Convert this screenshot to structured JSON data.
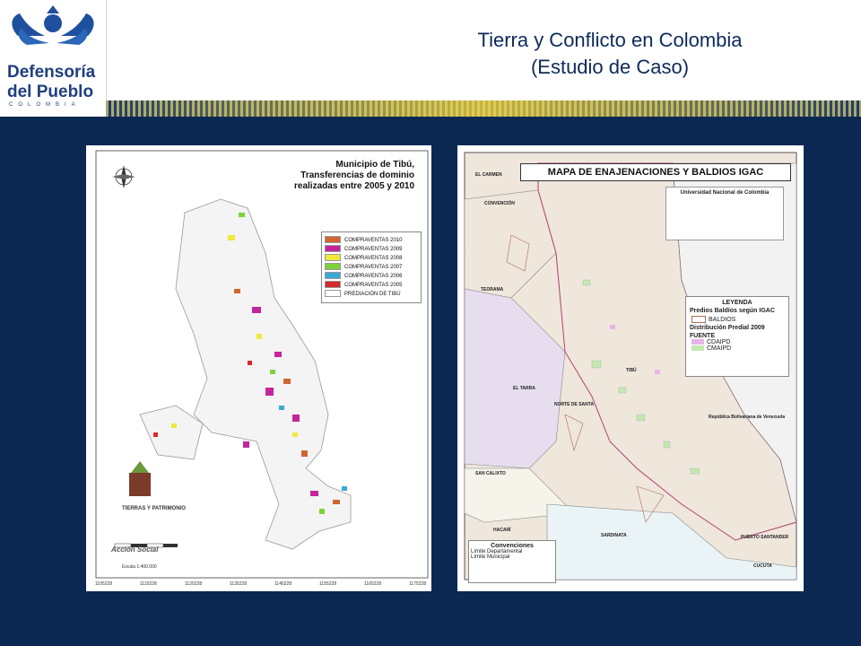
{
  "header": {
    "logo": {
      "line1": "Defensoría",
      "line2": "del Pueblo",
      "line3": "COLOMBIA"
    },
    "title_line1": "Tierra y Conflicto en Colombia",
    "title_line2": "(Estudio de Caso)"
  },
  "left_map": {
    "title_line1": "Municipio de Tibú,",
    "title_line2": "Transferencias de dominio",
    "title_line3": "realizadas entre 2005 y 2010",
    "legend": [
      {
        "label": "COMPRAVENTAS 2010",
        "color": "#d0662f"
      },
      {
        "label": "COMPRAVENTAS 2009",
        "color": "#c5259b"
      },
      {
        "label": "COMPRAVENTAS 2008",
        "color": "#f0e93a"
      },
      {
        "label": "COMPRAVENTAS 2007",
        "color": "#7dd23c"
      },
      {
        "label": "COMPRAVENTAS 2006",
        "color": "#3aa8d8"
      },
      {
        "label": "COMPRAVENTAS 2005",
        "color": "#d62a2a"
      },
      {
        "label": "PREDIACIÓN DE TIBÚ",
        "color": "#ffffff"
      }
    ],
    "scale_label": "Escala 1:400.000",
    "logo1": "TIERRAS Y PATRIMONIO",
    "logo2": "Acción Social",
    "x_ticks": [
      "1105228",
      "1115228",
      "1125228",
      "1135228",
      "1145228",
      "1155228",
      "1165228",
      "1175228"
    ]
  },
  "right_map": {
    "title": "MAPA DE ENAJENACIONES Y BALDIOS IGAC",
    "institution": "Universidad Nacional de Colombia",
    "legend_title": "LEYENDA",
    "legend_sub1": "Predios Baldíos según IGAC",
    "legend_item1": "BALDIOS",
    "legend_sub2": "Distribución Predial 2009",
    "legend_sub3": "FUENTE",
    "legend_item2": "CDAIPD",
    "legend_item3": "CMAIPD",
    "places": [
      "EL CARMEN",
      "CONVENCIÓN",
      "TEORAMA",
      "EL TARRA",
      "NORTE DE SANTA",
      "TIBÚ",
      "SAN CALIXTO",
      "HACARÍ",
      "SARDINATA",
      "PUERTO SANTANDER",
      "CUCUTA",
      "República Bolivariana de Venezuela"
    ],
    "convenciones_title": "Convenciones",
    "conv1": "Límite Departamental",
    "conv2": "Límite Municipal"
  }
}
